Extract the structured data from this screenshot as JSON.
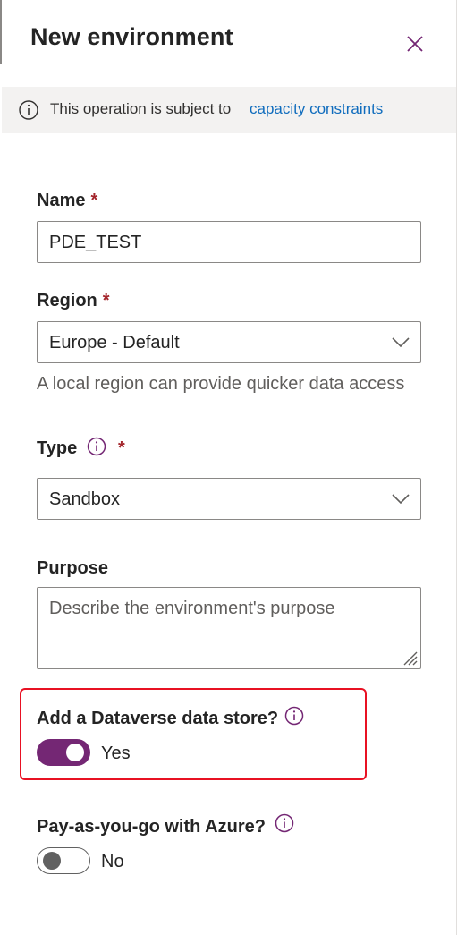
{
  "panel": {
    "title": "New environment",
    "close_icon": "close-icon"
  },
  "info_bar": {
    "icon": "info-icon",
    "message": "This operation is subject to",
    "link": "capacity constraints"
  },
  "form": {
    "name": {
      "label": "Name",
      "required_mark": "*",
      "value": "PDE_TEST"
    },
    "region": {
      "label": "Region",
      "required_mark": "*",
      "value": "Europe - Default",
      "hint": "A local region can provide quicker data access"
    },
    "type": {
      "label": "Type",
      "required_mark": "*",
      "value": "Sandbox"
    },
    "purpose": {
      "label": "Purpose",
      "placeholder": "Describe the environment's purpose"
    },
    "dataverse": {
      "label": "Add a Dataverse data store?",
      "state": "Yes",
      "on": true
    },
    "payg": {
      "label": "Pay-as-you-go with Azure?",
      "state": "No",
      "on": false
    }
  },
  "colors": {
    "accent": "#742774",
    "link": "#0f6cbd",
    "required": "#a4262c",
    "highlight_border": "#e81123"
  }
}
